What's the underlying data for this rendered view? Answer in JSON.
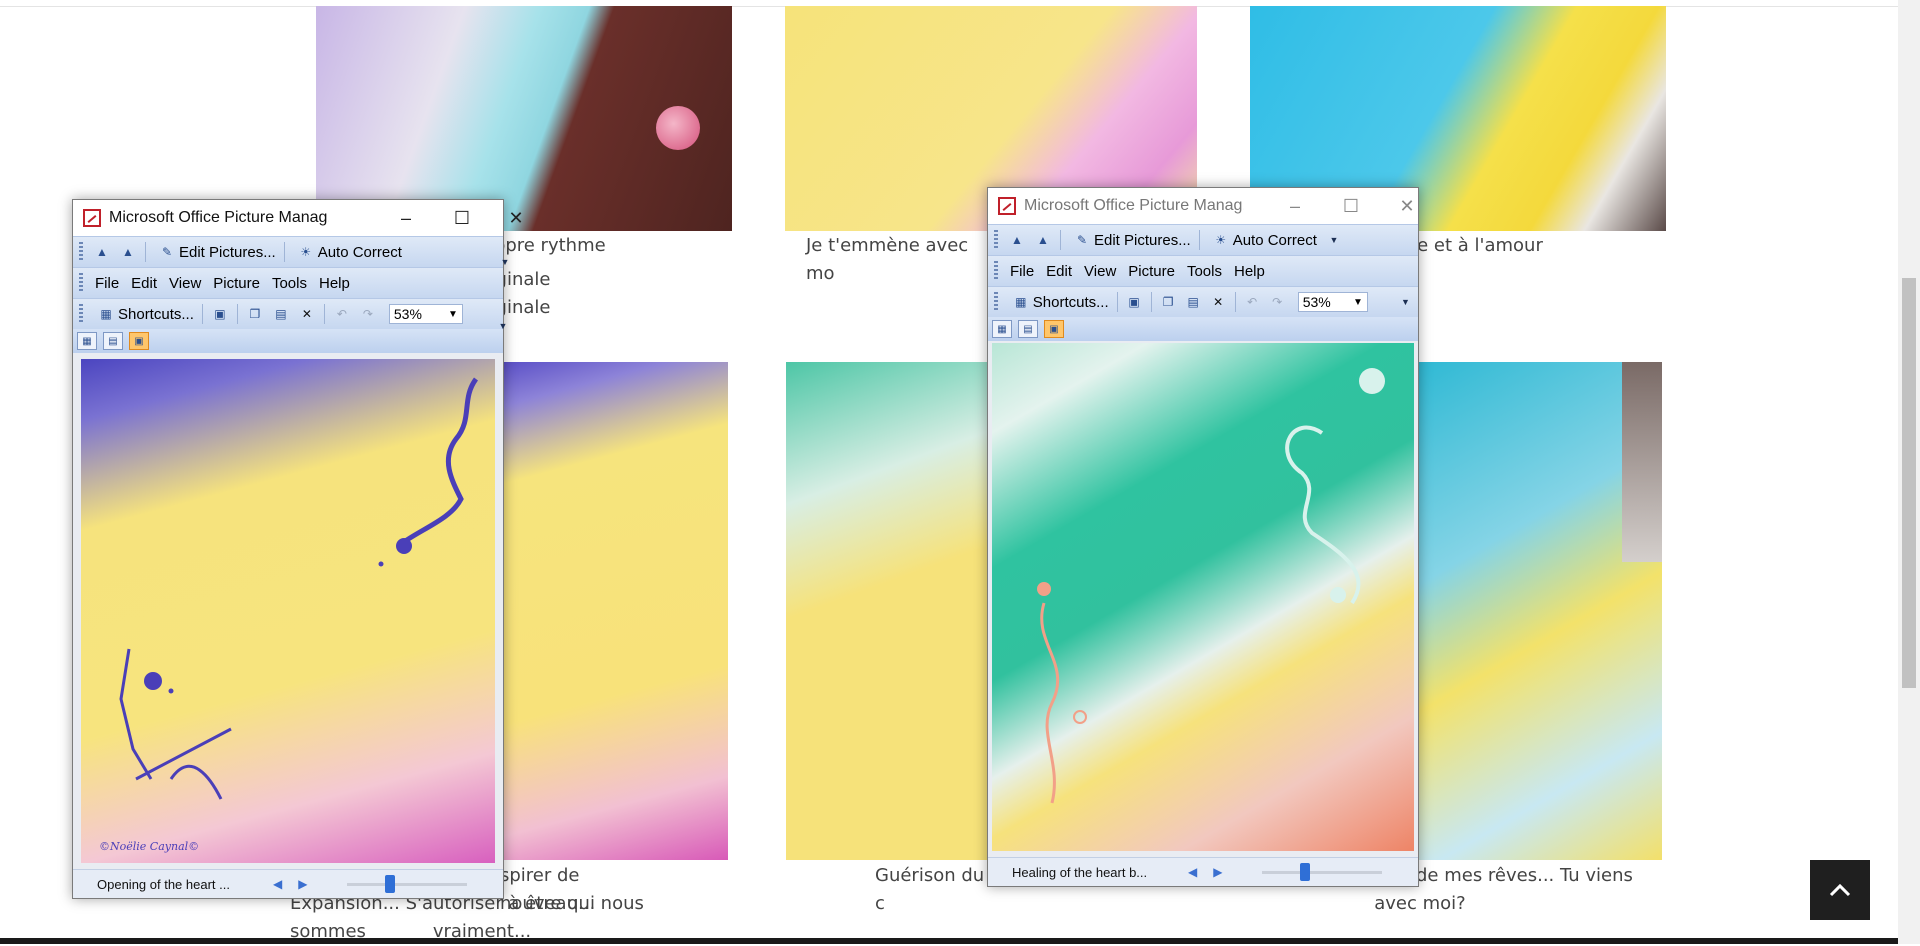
{
  "page": {
    "captions": {
      "c1_line1": "opre rythme",
      "c1_line2": "ginale",
      "c1_line3": "ginale",
      "c2_line1": "Je t'emmène avec mo",
      "c3_line1": "e et à l'amour",
      "c4_line1": "spirer de nouveau...",
      "c4_line2": "Expansion... S'autoriser à être qui nous sommes",
      "c4_line3": "vraiment...",
      "c5_line1": "Guérison du c",
      "c6_line1": "de mes rêves... Tu viens",
      "c6_line2": "avec moi?"
    },
    "back_to_top_icon": "chevron-up-icon"
  },
  "windows": [
    {
      "title": "Microsoft Office Picture Manag...",
      "toolbar1": {
        "edit_pictures": "Edit Pictures...",
        "auto_correct": "Auto Correct"
      },
      "menu": [
        "File",
        "Edit",
        "View",
        "Picture",
        "Tools",
        "Help"
      ],
      "toolbar2": {
        "shortcuts": "Shortcuts...",
        "zoom": "53%"
      },
      "status": {
        "file_name": "Opening of the heart ..."
      },
      "signature": "©Noëlie Caynal©"
    },
    {
      "title": "Microsoft Office Picture Manag...",
      "toolbar1": {
        "edit_pictures": "Edit Pictures...",
        "auto_correct": "Auto Correct"
      },
      "menu": [
        "File",
        "Edit",
        "View",
        "Picture",
        "Tools",
        "Help"
      ],
      "toolbar2": {
        "shortcuts": "Shortcuts...",
        "zoom": "53%"
      },
      "status": {
        "file_name": "Healing of the heart b..."
      }
    }
  ],
  "colors": {
    "toolbar_blue": "#c6d7f0",
    "active_view": "#ffc66b",
    "accent_blue": "#2f6fd6"
  }
}
